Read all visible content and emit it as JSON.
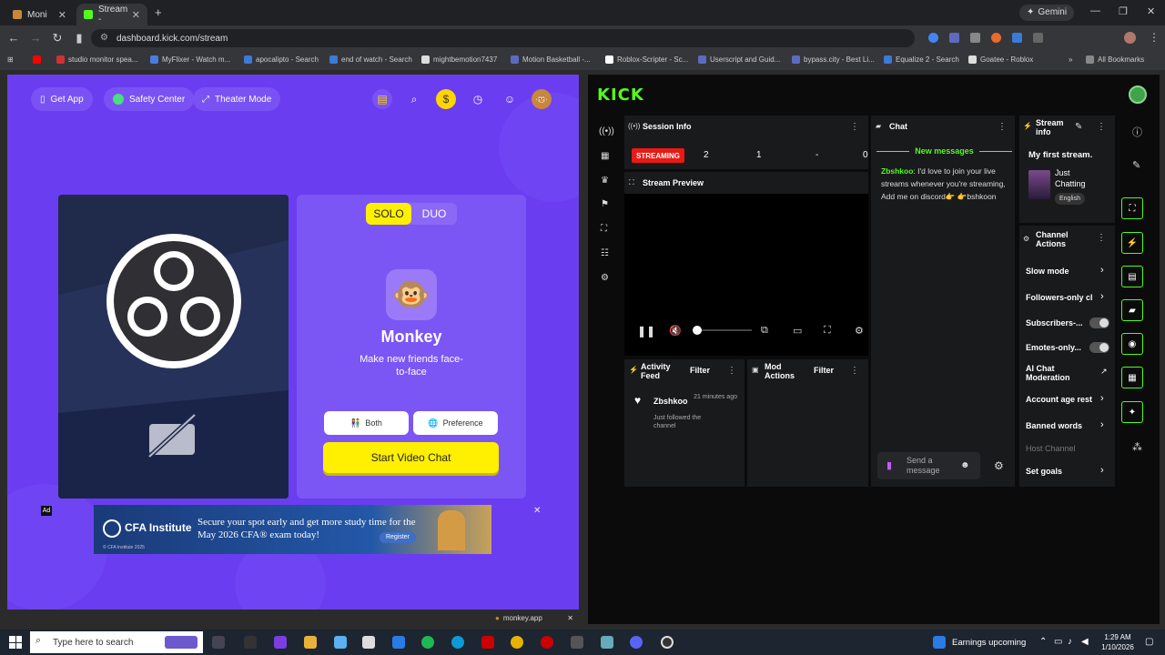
{
  "browser": {
    "tabs": [
      {
        "title": "Moni",
        "active": false
      },
      {
        "title": "Stream -",
        "active": true
      }
    ],
    "gemini_label": "Gemini",
    "url": "dashboard.kick.com/stream",
    "bookmarks": [
      "studio monitor spea...",
      "MyFlixer - Watch m...",
      "apocalipto - Search",
      "end of watch - Search",
      "mightbemotion7437",
      "Motion Basketball -...",
      "Roblox-Scripter - Sc...",
      "Userscript and Guid...",
      "bypass.city - Best Li...",
      "Equalize 2 - Search",
      "Goatee - Roblox",
      "All Bookmarks"
    ]
  },
  "monkey": {
    "top_buttons": [
      "Get App",
      "Safety Center",
      "Theater Mode"
    ],
    "mode_solo": "SOLO",
    "mode_duo": "DUO",
    "app_name": "Monkey",
    "tagline": "Make new friends face-to-face",
    "both_label": "Both",
    "preference_label": "Preference",
    "start_label": "Start Video Chat",
    "ad_label": "Ad",
    "ad_brand": "CFA Institute",
    "ad_text": "Secure your spot early and get more study time for the May 2026 CFA® exam today!",
    "ad_cta": "Register",
    "ad_copyright": "© CFA Institute 2025",
    "popup_label": "monkey.app"
  },
  "kick": {
    "logo": "KICK",
    "session_info": "Session Info",
    "streaming_badge": "STREAMING",
    "stats": [
      "2",
      "1",
      "-",
      "0"
    ],
    "stream_preview": "Stream Preview",
    "chat_title": "Chat",
    "new_messages": "New messages",
    "chat_user": "Zbshkoo",
    "chat_message": ": I'd love to join your live streams whenever you're streaming, Add me on discord👉 👉bshkoon",
    "send_placeholder": "Send a message",
    "stream_info_title": "Stream info",
    "stream_title": "My first stream.",
    "category": "Just Chatting",
    "language": "English",
    "channel_actions": "Channel Actions",
    "actions": [
      "Slow mode",
      "Followers-only cl",
      "Subscribers-...",
      "Emotes-only...",
      "AI Chat Moderation",
      "Account age rest",
      "Banned words",
      "Host Channel",
      "Set goals"
    ],
    "activity_feed": "Activity Feed",
    "filter": "Filter",
    "mod_actions": "Mod Actions",
    "feed_user": "Zbshkoo",
    "feed_time": "21 minutes ago",
    "feed_event": "Just followed the channel"
  },
  "taskbar": {
    "search_placeholder": "Type here to search",
    "news": "Earnings upcoming",
    "time": "1:29 AM",
    "date": "1/10/2026"
  },
  "colors": {
    "kick_green": "#53fc18",
    "monkey_purple": "#6a3df0",
    "yellow": "#ffef00",
    "streaming_red": "#e91916"
  }
}
